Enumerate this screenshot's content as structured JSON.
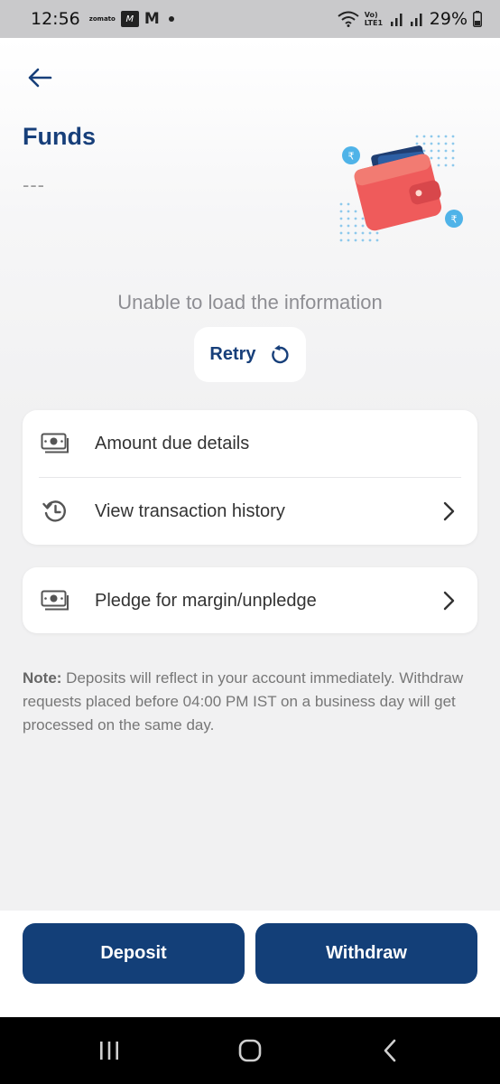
{
  "status_bar": {
    "time": "12:56",
    "zomato_label": "zomato",
    "myntra_label": "M",
    "gmail_label": "M",
    "battery_text": "29%",
    "network_label": "Vo) LTE1"
  },
  "header": {
    "title": "Funds",
    "value": "---"
  },
  "error": {
    "message": "Unable to load the information",
    "retry_label": "Retry"
  },
  "menu_cards": [
    {
      "items": [
        {
          "label": "Amount due details",
          "icon": "money-icon",
          "chevron": false
        },
        {
          "label": "View transaction history",
          "icon": "history-icon",
          "chevron": true
        }
      ]
    },
    {
      "items": [
        {
          "label": "Pledge for margin/unpledge",
          "icon": "money-icon",
          "chevron": true
        }
      ]
    }
  ],
  "note": {
    "prefix": "Note:",
    "text": " Deposits will reflect in your account immediately. Withdraw requests placed before 04:00 PM IST on a business day will get processed on the same day."
  },
  "actions": {
    "deposit_label": "Deposit",
    "withdraw_label": "Withdraw"
  },
  "colors": {
    "brand": "#173f7a",
    "button": "#133f78",
    "wallet": "#ef5b5b",
    "coin": "#4fb3e8"
  },
  "icons": [
    "back-arrow-icon",
    "wallet-icon",
    "retry-icon",
    "money-icon",
    "history-icon",
    "chevron-right-icon",
    "recents-icon",
    "home-icon",
    "back-nav-icon",
    "wifi-icon",
    "signal-icon",
    "battery-icon"
  ]
}
